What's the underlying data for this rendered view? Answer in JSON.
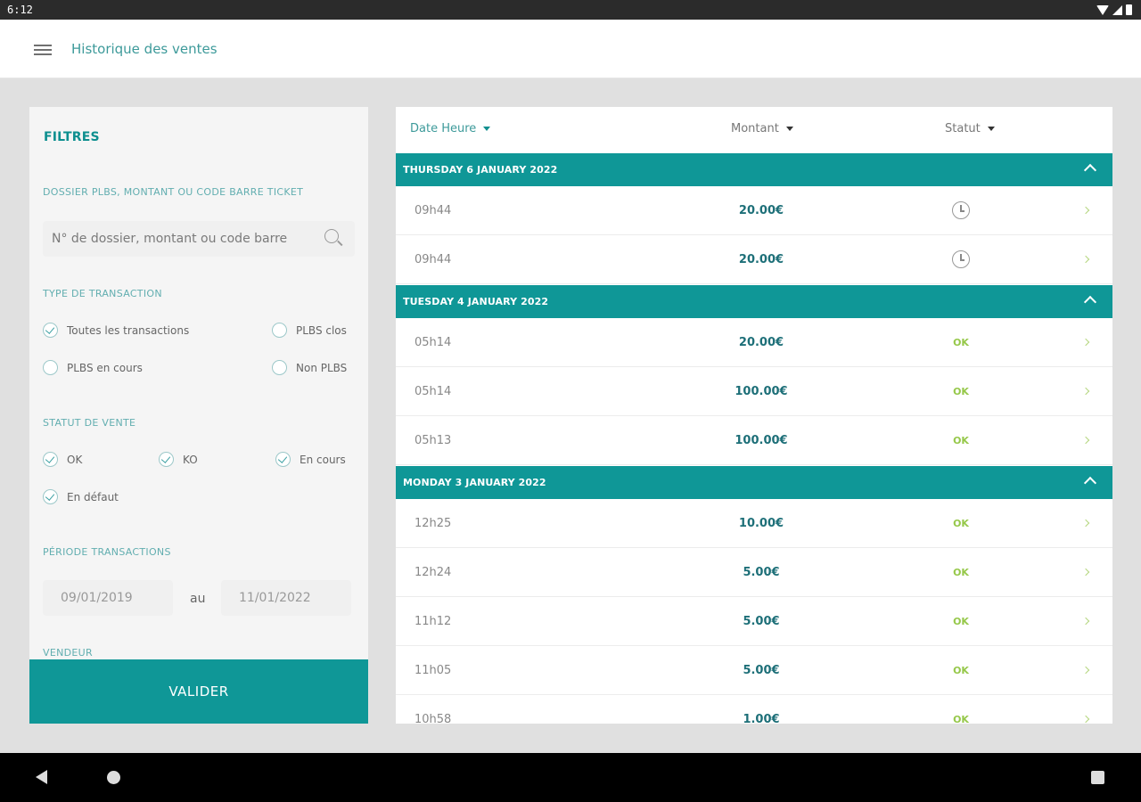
{
  "status_bar": {
    "time": "6:12",
    "wifi_icon": "wifi-icon",
    "signal_icon": "signal-icon",
    "battery_icon": "battery-icon"
  },
  "app_bar": {
    "title": "Historique des ventes",
    "menu_icon": "menu-icon"
  },
  "filters": {
    "title": "FILTRES",
    "search": {
      "label": "DOSSIER PLBS, MONTANT OU CODE BARRE TICKET",
      "placeholder": "N° de dossier, montant ou code barre",
      "value": ""
    },
    "transaction_type": {
      "label": "TYPE DE TRANSACTION",
      "options": [
        {
          "label": "Toutes les transactions",
          "checked": true
        },
        {
          "label": "PLBS clos",
          "checked": false
        },
        {
          "label": "PLBS en cours",
          "checked": false
        },
        {
          "label": "Non PLBS",
          "checked": false
        }
      ]
    },
    "sale_status": {
      "label": "STATUT DE VENTE",
      "options": [
        {
          "label": "OK",
          "checked": true
        },
        {
          "label": "KO",
          "checked": true
        },
        {
          "label": "En cours",
          "checked": true
        },
        {
          "label": "En défaut",
          "checked": true
        }
      ]
    },
    "period": {
      "label": "PÉRIODE TRANSACTIONS",
      "from": "09/01/2019",
      "separator": "au",
      "to": "11/01/2022"
    },
    "seller_label": "VENDEUR",
    "validate_label": "VALIDER"
  },
  "list": {
    "columns": [
      {
        "label": "Date Heure"
      },
      {
        "label": "Montant"
      },
      {
        "label": "Statut"
      }
    ],
    "groups": [
      {
        "date": "THURSDAY 6 JANUARY 2022",
        "rows": [
          {
            "time": "09h44",
            "amount": "20.00€",
            "status": "",
            "status_icon": "clock-icon"
          },
          {
            "time": "09h44",
            "amount": "20.00€",
            "status": "",
            "status_icon": "clock-icon"
          }
        ]
      },
      {
        "date": "TUESDAY 4 JANUARY 2022",
        "rows": [
          {
            "time": "05h14",
            "amount": "20.00€",
            "status": "OK"
          },
          {
            "time": "05h14",
            "amount": "100.00€",
            "status": "OK"
          },
          {
            "time": "05h13",
            "amount": "100.00€",
            "status": "OK"
          }
        ]
      },
      {
        "date": "MONDAY 3 JANUARY 2022",
        "rows": [
          {
            "time": "12h25",
            "amount": "10.00€",
            "status": "OK"
          },
          {
            "time": "12h24",
            "amount": "5.00€",
            "status": "OK"
          },
          {
            "time": "11h12",
            "amount": "5.00€",
            "status": "OK"
          },
          {
            "time": "11h05",
            "amount": "5.00€",
            "status": "OK"
          },
          {
            "time": "10h58",
            "amount": "1.00€",
            "status": "OK"
          }
        ]
      }
    ]
  },
  "colors": {
    "teal": "#0f9797",
    "ok_green": "#96c84a",
    "amount": "#1d6f78"
  }
}
